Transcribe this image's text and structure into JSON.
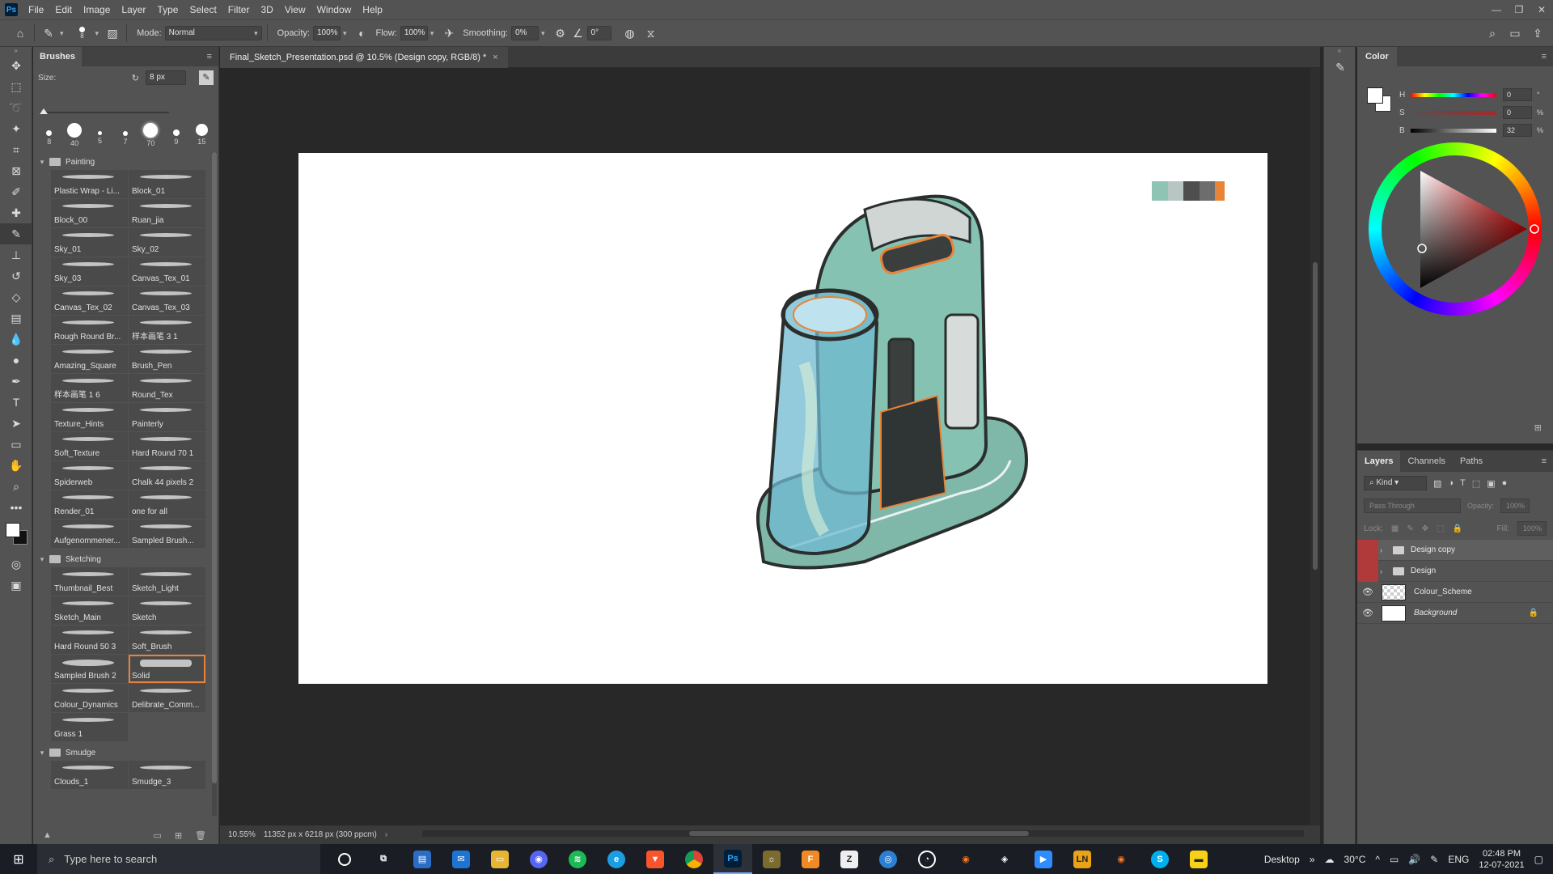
{
  "app": {
    "logo": "Ps"
  },
  "menu": [
    "File",
    "Edit",
    "Image",
    "Layer",
    "Type",
    "Select",
    "Filter",
    "3D",
    "View",
    "Window",
    "Help"
  ],
  "window_controls": {
    "minimize": "—",
    "restore": "❐",
    "close": "✕"
  },
  "options": {
    "brush_size_value": "8",
    "mode_label": "Mode:",
    "mode_value": "Normal",
    "opacity_label": "Opacity:",
    "opacity_value": "100%",
    "flow_label": "Flow:",
    "flow_value": "100%",
    "smoothing_label": "Smoothing:",
    "smoothing_value": "0%",
    "angle_value": "0°"
  },
  "tools": [
    "move-tool-icon",
    "marquee-tool-icon",
    "lasso-tool-icon",
    "magic-wand-tool-icon",
    "crop-tool-icon",
    "frame-tool-icon",
    "eyedropper-tool-icon",
    "healing-brush-tool-icon",
    "brush-tool-icon",
    "clone-stamp-tool-icon",
    "history-brush-tool-icon",
    "eraser-tool-icon",
    "gradient-tool-icon",
    "blur-tool-icon",
    "dodge-tool-icon",
    "pen-tool-icon",
    "type-tool-icon",
    "path-selection-tool-icon",
    "rectangle-tool-icon",
    "hand-tool-icon",
    "zoom-tool-icon",
    "more-tools-icon"
  ],
  "brushes": {
    "tab": "Brushes",
    "size_label": "Size:",
    "size_value": "8 px",
    "presets": [
      "8",
      "40",
      "5",
      "7",
      "70",
      "9",
      "15"
    ],
    "groups": [
      {
        "name": "Painting",
        "items": [
          "Plastic Wrap - Li...",
          "Block_01",
          "Block_00",
          "Ruan_jia",
          "Sky_01",
          "Sky_02",
          "Sky_03",
          "Canvas_Tex_01",
          "Canvas_Tex_02",
          "Canvas_Tex_03",
          "Rough Round Br...",
          "样本画笔 3 1",
          "Amazing_Square",
          "Brush_Pen",
          "样本画笔 1 6",
          "Round_Tex",
          "Texture_Hints",
          "Painterly",
          "Soft_Texture",
          "Hard Round 70 1",
          "Spiderweb",
          "Chalk 44 pixels 2",
          "Render_01",
          "one for all",
          "Aufgenommener...",
          "Sampled Brush..."
        ]
      },
      {
        "name": "Sketching",
        "items": [
          "Thumbnail_Best",
          "Sketch_Light",
          "Sketch_Main",
          "Sketch",
          "Hard Round 50 3",
          "Soft_Brush",
          "Sampled Brush 2",
          "Solid",
          "Colour_Dynamics",
          "Delibrate_Comm...",
          "Grass 1"
        ]
      },
      {
        "name": "Smudge",
        "items": [
          "Clouds_1",
          "Smudge_3"
        ]
      }
    ],
    "selected": "Solid"
  },
  "document": {
    "tab_title": "Final_Sketch_Presentation.psd @ 10.5% (Design copy, RGB/8) *",
    "zoom": "10.55%",
    "doc_info": "11352 px x 6218 px (300 ppcm)",
    "palette_colors": [
      "#8fc4b4",
      "#b7c6c2",
      "#4e4e4e",
      "#6d6d6d",
      "#e8843a"
    ]
  },
  "color": {
    "tab": "Color",
    "h_label": "H",
    "h_value": "0",
    "s_label": "S",
    "s_value": "0",
    "b_label": "B",
    "b_value": "32",
    "h_unit": "°",
    "s_unit": "%",
    "b_unit": "%"
  },
  "layers": {
    "tabs": [
      "Layers",
      "Channels",
      "Paths"
    ],
    "filter_label": "Kind",
    "blend_mode": "Pass Through",
    "opacity_label": "Opacity:",
    "opacity_value": "100%",
    "lock_label": "Lock:",
    "fill_label": "Fill:",
    "fill_value": "100%",
    "items": [
      {
        "name": "Design copy",
        "type": "group"
      },
      {
        "name": "Design",
        "type": "group"
      },
      {
        "name": "Colour_Scheme",
        "type": "layer"
      },
      {
        "name": "Background",
        "type": "background"
      }
    ]
  },
  "taskbar": {
    "search_placeholder": "Type here to search",
    "desktop_label": "Desktop",
    "temperature": "30°C",
    "language": "ENG",
    "time": "02:48 PM",
    "date": "12-07-2021"
  }
}
